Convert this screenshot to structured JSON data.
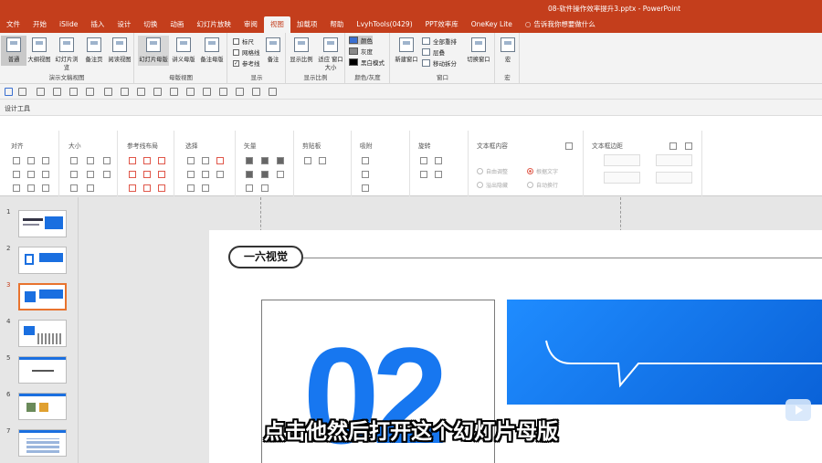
{
  "window": {
    "title": "08-软件操作效率提升3.pptx  -  PowerPoint"
  },
  "tabs": [
    "文件",
    "开始",
    "iSlide",
    "插入",
    "设计",
    "切换",
    "动画",
    "幻灯片放映",
    "审阅",
    "视图",
    "加载项",
    "帮助",
    "LvyhTools(0429)",
    "PPT效率库",
    "OneKey Lite"
  ],
  "active_tab": "视图",
  "tell_me": "告诉我你想要做什么",
  "ribbon": {
    "presentation_views": {
      "label": "演示文稿视图",
      "buttons": [
        "普通",
        "大纲视图",
        "幻灯片浏览",
        "备注页",
        "阅读视图"
      ]
    },
    "master_views": {
      "label": "母版视图",
      "buttons": [
        "幻灯片母版",
        "讲义母版",
        "备注母版"
      ]
    },
    "show": {
      "label": "显示",
      "checks": [
        {
          "label": "标尺",
          "checked": false
        },
        {
          "label": "网格线",
          "checked": false
        },
        {
          "label": "参考线",
          "checked": true
        }
      ],
      "notes": "备注"
    },
    "zoom": {
      "label": "显示比例",
      "buttons": [
        "显示比例",
        "适应\n窗口大小"
      ]
    },
    "color": {
      "label": "颜色/灰度",
      "options": [
        "颜色",
        "灰度",
        "黑白模式"
      ]
    },
    "window": {
      "label": "窗口",
      "new_window": "新建窗口",
      "items": [
        "全部重排",
        "层叠",
        "移动拆分"
      ],
      "switch": "切换窗口"
    },
    "macros": {
      "label": "宏",
      "button": "宏"
    }
  },
  "design_tools": {
    "title": "设计工具",
    "sections": [
      "对齐",
      "大小",
      "参考线布局",
      "选择",
      "矢量",
      "剪贴板",
      "吸附",
      "旋转",
      "文本框内容",
      "文本框边距"
    ],
    "textbox_options": [
      "自由调整",
      "根据文字",
      "溢出隐藏",
      "自动换行"
    ]
  },
  "thumbnails": [
    "1",
    "2",
    "3",
    "4",
    "5",
    "6",
    "7"
  ],
  "active_slide": "3",
  "slide": {
    "badge": "一六视觉",
    "number": "02"
  },
  "subtitle": "点击他然后打开这个幻灯片母版",
  "colors": {
    "accent": "#c43e1c",
    "blue": "#1777f0",
    "highlight": "#e8732e"
  }
}
